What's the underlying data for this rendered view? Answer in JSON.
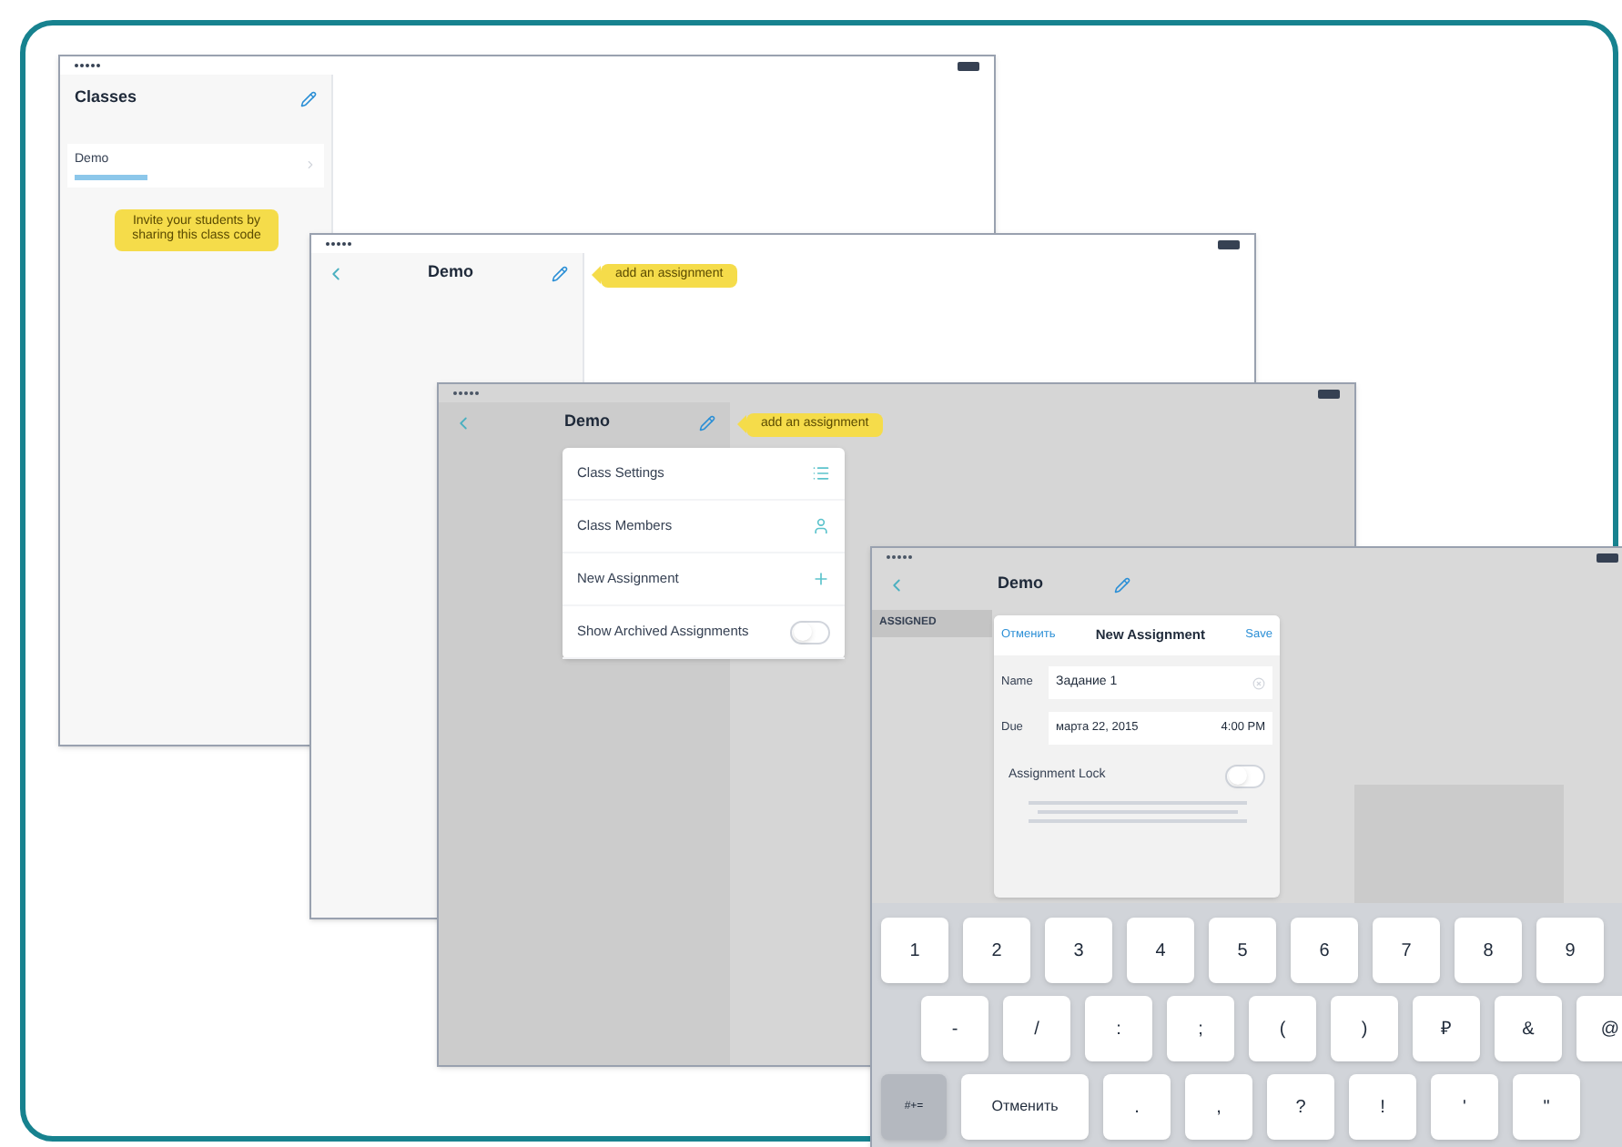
{
  "classes_screen": {
    "header_title": "Classes",
    "class_item": {
      "name": "Demo"
    },
    "tooltip": "Invite your students by sharing this class code"
  },
  "demo_screen": {
    "title": "Demo",
    "tooltip": "add an assignment"
  },
  "menu_screen": {
    "title": "Demo",
    "tooltip": "add an assignment",
    "menu": [
      {
        "label": "Class Settings",
        "kind": "list"
      },
      {
        "label": "Class Members",
        "kind": "person"
      },
      {
        "label": "New Assignment",
        "kind": "plus"
      },
      {
        "label": "Show Archived Assignments",
        "kind": "toggle",
        "on": false
      }
    ]
  },
  "assignment_screen": {
    "title": "Demo",
    "section": "ASSIGNED",
    "dialog": {
      "cancel": "Отменить",
      "title": "New Assignment",
      "save": "Save",
      "name_label": "Name",
      "name_value": "Задание 1",
      "due_label": "Due",
      "due_date": "марта 22, 2015",
      "due_time": "4:00 PM",
      "lock_label": "Assignment Lock",
      "lock_on": false
    },
    "keyboard": [
      [
        {
          "label": "1"
        },
        {
          "label": "2"
        },
        {
          "label": "3"
        },
        {
          "label": "4"
        },
        {
          "label": "5"
        },
        {
          "label": "6"
        },
        {
          "label": "7"
        },
        {
          "label": "8"
        },
        {
          "label": "9"
        }
      ],
      [
        {
          "label": "-"
        },
        {
          "label": "/"
        },
        {
          "label": ":"
        },
        {
          "label": ";"
        },
        {
          "label": "("
        },
        {
          "label": ")"
        },
        {
          "label": "₽"
        },
        {
          "label": "&"
        },
        {
          "label": "@"
        }
      ],
      [
        {
          "label": "#+=",
          "kind": "mode"
        },
        {
          "label": "Отменить",
          "kind": "wide"
        },
        {
          "label": "."
        },
        {
          "label": ","
        },
        {
          "label": "?"
        },
        {
          "label": "!"
        },
        {
          "label": "'"
        },
        {
          "label": "\""
        }
      ]
    ]
  }
}
